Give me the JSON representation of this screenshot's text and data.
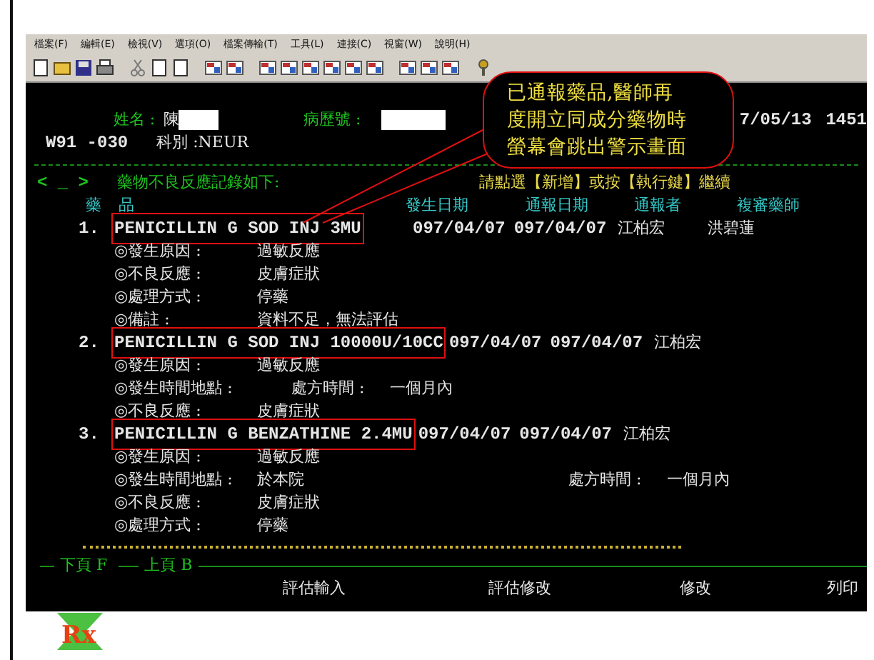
{
  "menu": [
    "檔案(F)",
    "編輯(E)",
    "檢視(V)",
    "選項(O)",
    "檔案傳輸(T)",
    "工具(L)",
    "連接(C)",
    "視窗(W)",
    "說明(H)"
  ],
  "patient": {
    "name_label": "姓名 :",
    "name": "陳",
    "chart_label": "病歷號 :",
    "date": "7/05/13",
    "time": "1451",
    "ward": "W91 -030",
    "dept": "科別 :NEUR"
  },
  "list_header": {
    "cursor": "< _ >",
    "title": "藥物不良反應記錄如下:",
    "prompt": "請點選【新增】或按【執行鍵】繼續"
  },
  "columns": [
    "藥",
    "品",
    "發生日期",
    "通報日期",
    "通報者",
    "複審藥師"
  ],
  "records": [
    {
      "no": "1.",
      "drug": "PENICILLIN G SOD INJ 3MU",
      "highlighted": true,
      "onset_date": "097/04/07",
      "report_date": "097/04/07",
      "reporter": "江柏宏",
      "reviewer": "洪碧蓮",
      "details": [
        {
          "label": "◎發生原因 :",
          "value": "過敏反應"
        },
        {
          "label": "◎不良反應 :",
          "value": "皮膚症狀"
        },
        {
          "label": "◎處理方式 :",
          "value": "停藥"
        },
        {
          "label": "◎備註 :",
          "value": "資料不足，無法評估"
        }
      ]
    },
    {
      "no": "2.",
      "drug": "PENICILLIN G SOD INJ 10000U/10CC",
      "highlighted": true,
      "onset_date": "097/04/07",
      "report_date": "097/04/07",
      "reporter": "江柏宏",
      "details": [
        {
          "label": "◎發生原因 :",
          "value": "過敏反應"
        },
        {
          "label": "◎發生時間地點 :",
          "extra_label": "處方時間 :",
          "extra_value": "一個月內"
        },
        {
          "label": "◎不良反應 :",
          "value": "皮膚症狀"
        }
      ]
    },
    {
      "no": "3.",
      "drug": "PENICILLIN G BENZATHINE 2.4MU",
      "highlighted": true,
      "onset_date": "097/04/07",
      "report_date": "097/04/07",
      "reporter": "江柏宏",
      "details": [
        {
          "label": "◎發生原因 :",
          "value": "過敏反應"
        },
        {
          "label": "◎發生時間地點 :",
          "value": "於本院",
          "extra_label": "處方時間 :",
          "extra_value": "一個月內"
        },
        {
          "label": "◎不良反應 :",
          "value": "皮膚症狀"
        },
        {
          "label": "◎處理方式 :",
          "value": "停藥"
        }
      ]
    }
  ],
  "paging": [
    "下頁 F",
    "上頁 B"
  ],
  "function_keys": [
    "評估輸入",
    "評估修改",
    "修改",
    "列印"
  ],
  "callout": {
    "lines": [
      "已通報藥品,醫師再",
      "度開立同成分藥物時",
      "螢幕會跳出警示畫面"
    ]
  },
  "logo": {
    "text": "Rx"
  }
}
